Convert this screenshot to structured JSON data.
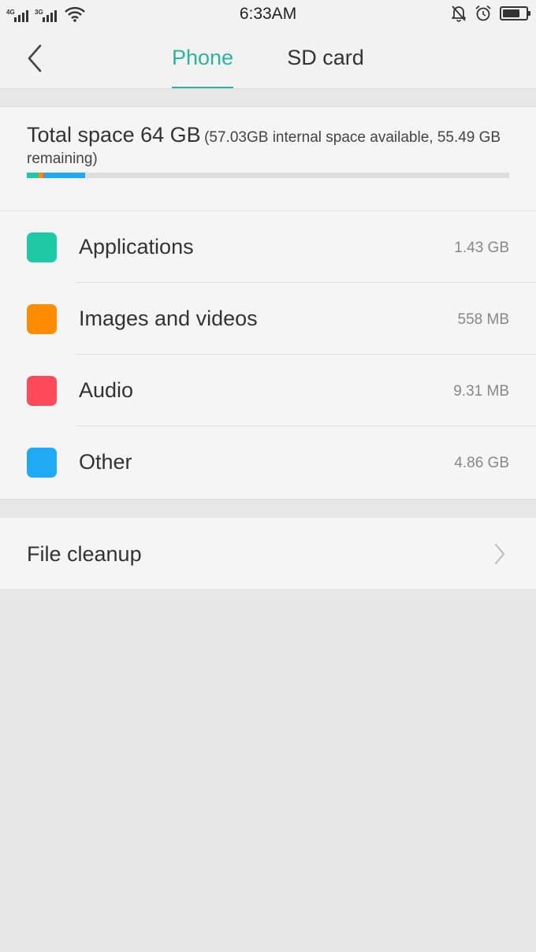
{
  "status_bar": {
    "time": "6:33AM",
    "sim1_network": "4G",
    "sim2_network": "3G",
    "icons": [
      "signal-icon",
      "wifi-icon",
      "mute-icon",
      "alarm-icon",
      "battery-icon"
    ],
    "battery_level": 0.75
  },
  "header": {
    "tabs": [
      {
        "label": "Phone",
        "active": true
      },
      {
        "label": "SD card",
        "active": false
      }
    ]
  },
  "summary": {
    "total": "Total space 64 GB",
    "detail": "(57.03GB internal space available, 55.49 GB remaining)",
    "usage_fractions": [
      {
        "name": "Applications",
        "fraction": 0.025,
        "color": "#1ec9a6"
      },
      {
        "name": "Images and videos",
        "fraction": 0.0098,
        "color": "#ff8c00"
      },
      {
        "name": "Audio",
        "fraction": 0.0002,
        "color": "#ff4a5a"
      },
      {
        "name": "Other",
        "fraction": 0.0852,
        "color": "#1faaf3"
      }
    ]
  },
  "categories": [
    {
      "label": "Applications",
      "size": "1.43 GB",
      "color": "#1ec9a6"
    },
    {
      "label": "Images and videos",
      "size": "558 MB",
      "color": "#ff8c00"
    },
    {
      "label": "Audio",
      "size": "9.31 MB",
      "color": "#ff4a5a"
    },
    {
      "label": "Other",
      "size": "4.86 GB",
      "color": "#1faaf3"
    }
  ],
  "cleanup": {
    "label": "File cleanup"
  },
  "colors": {
    "accent": "#2eb39a",
    "background": "#e8e7e8",
    "card": "#f6f5f6"
  }
}
